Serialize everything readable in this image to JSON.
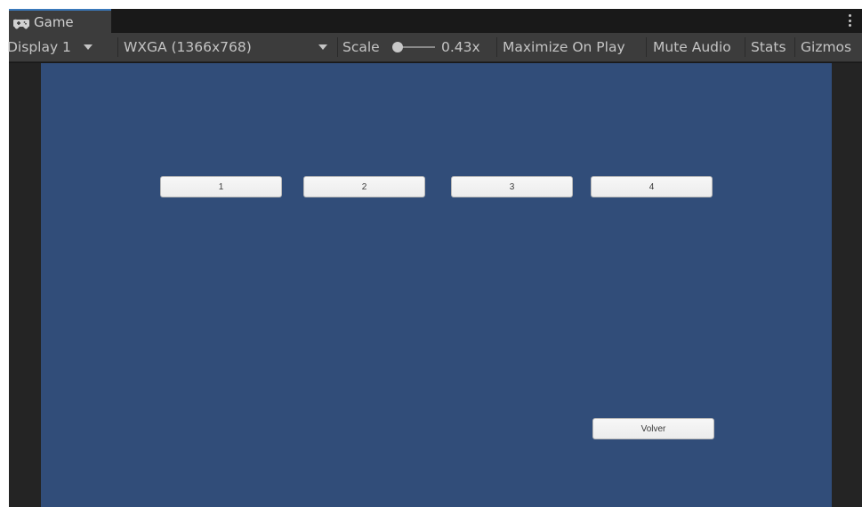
{
  "tab": {
    "title": "Game",
    "icon": "gamepad-icon"
  },
  "toolbar": {
    "display": "Display 1",
    "resolution": "WXGA (1366x768)",
    "scale_label": "Scale",
    "scale_value": "0.43x",
    "maximize_on_play": "Maximize On Play",
    "mute_audio": "Mute Audio",
    "stats": "Stats",
    "gizmos": "Gizmos"
  },
  "game": {
    "buttons": [
      "1",
      "2",
      "3",
      "4"
    ],
    "back_button": "Volver"
  },
  "colors": {
    "canvas_bg": "#314d79",
    "toolbar_bg": "#3c3c3c",
    "tab_accent": "#3a79bb"
  }
}
